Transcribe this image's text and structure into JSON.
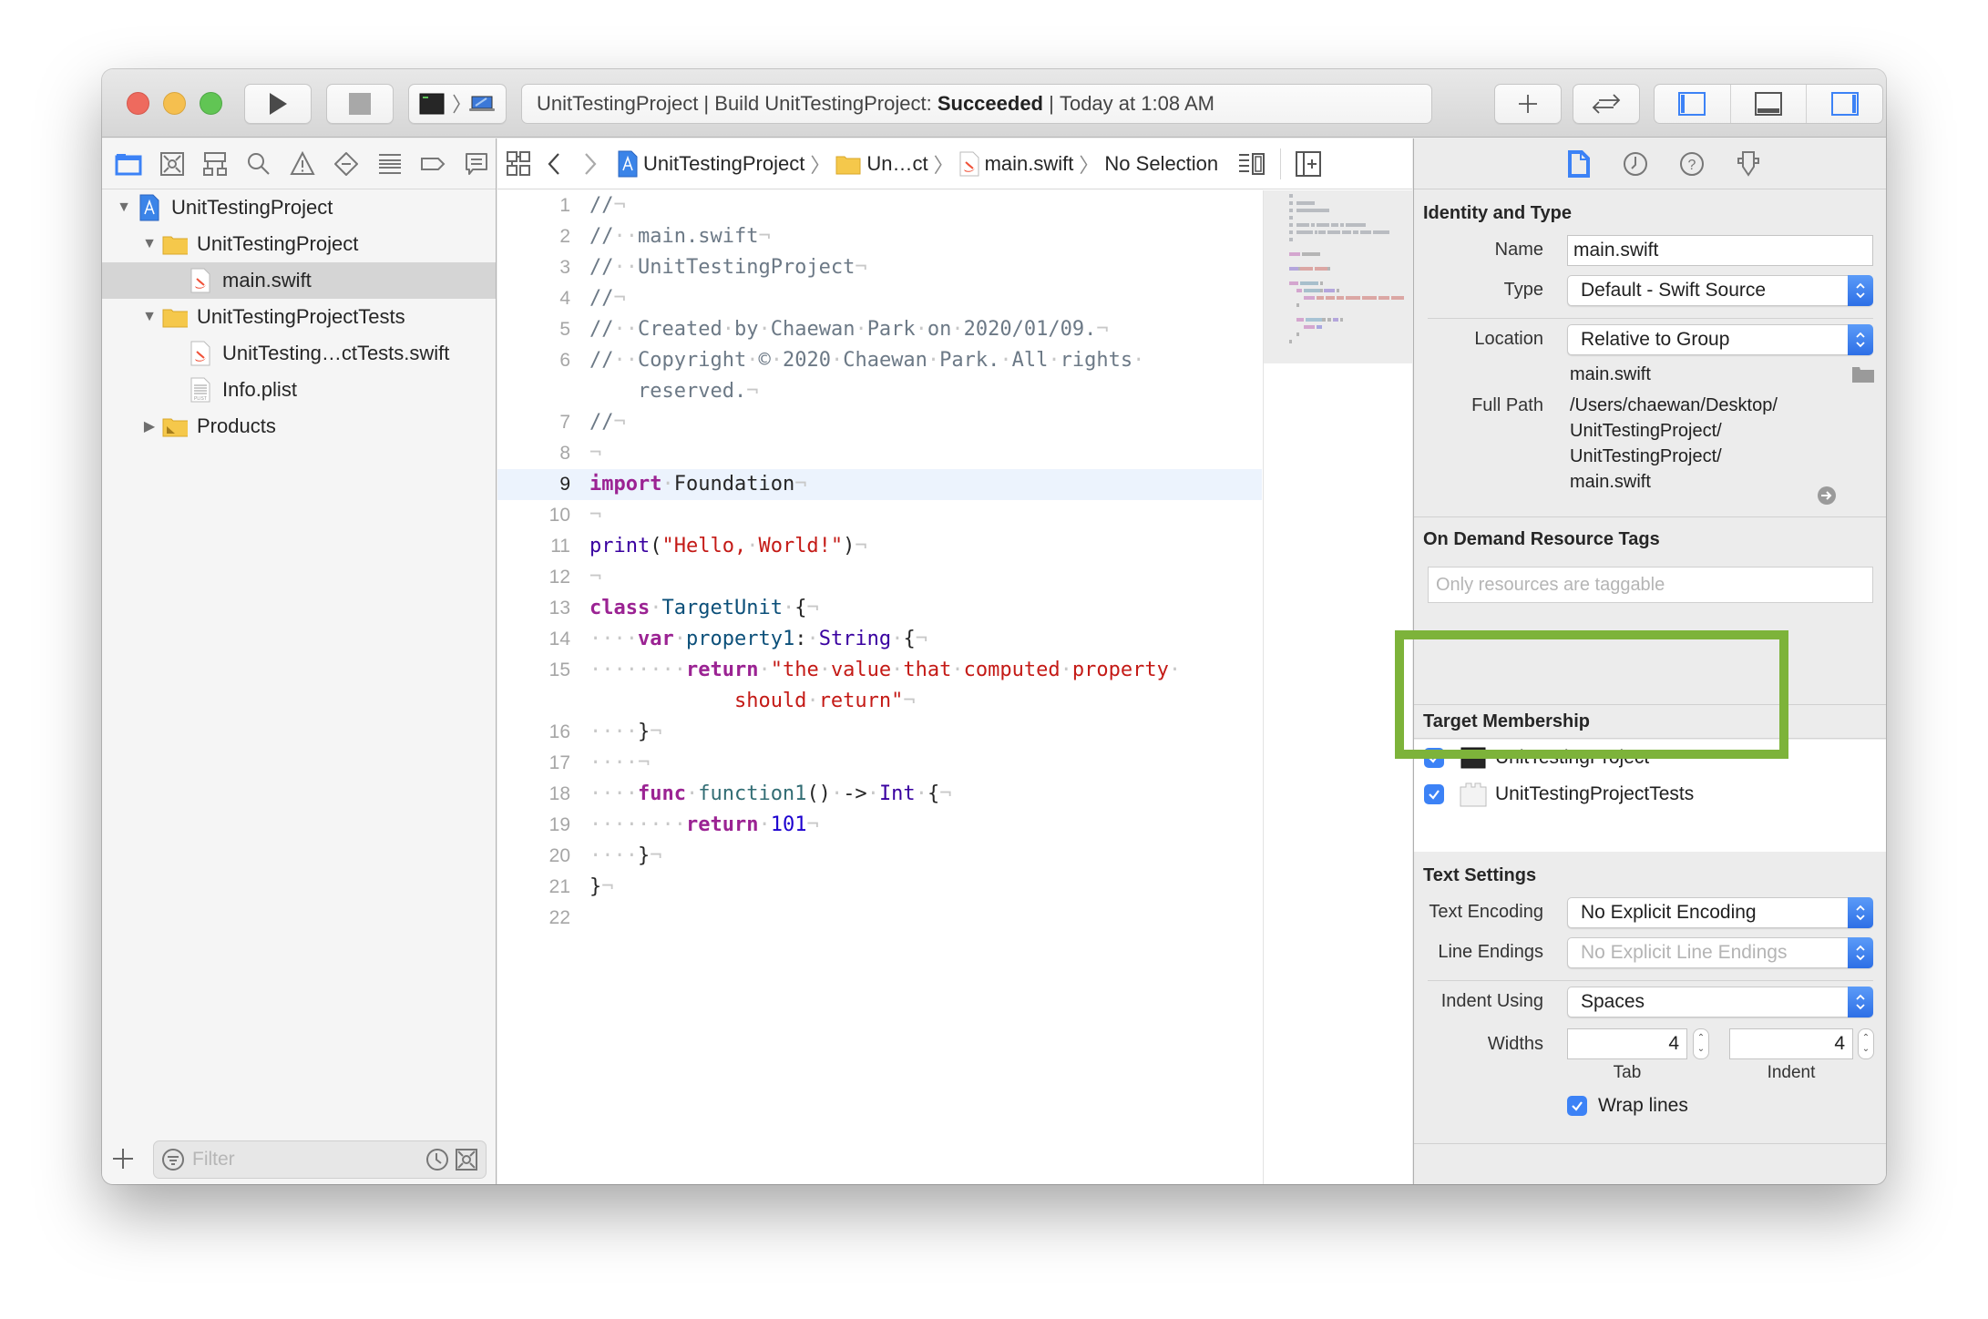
{
  "window": {
    "controls": [
      "close",
      "minimize",
      "zoom"
    ]
  },
  "toolbar": {
    "run_icon": "play-icon",
    "stop_icon": "stop-icon",
    "scheme_icon": "terminal-app-icon",
    "destination_icon": "macbook-icon",
    "status": {
      "project": "UnitTestingProject",
      "separator": " | ",
      "action": "Build UnitTestingProject: ",
      "result": "Succeeded",
      "time": "Today at 1:08 AM"
    },
    "library_icon": "plus-icon",
    "review_icon": "swap-arrows-icon",
    "layout_toggles": [
      {
        "name": "navigator",
        "active": true
      },
      {
        "name": "debug-area",
        "active": false
      },
      {
        "name": "inspector",
        "active": true
      }
    ]
  },
  "navigator": {
    "tabs": [
      {
        "icon": "folder-icon",
        "active": true
      },
      {
        "icon": "source-control-icon"
      },
      {
        "icon": "symbol-hierarchy-icon"
      },
      {
        "icon": "search-icon"
      },
      {
        "icon": "warning-icon"
      },
      {
        "icon": "test-diamond-icon"
      },
      {
        "icon": "debug-list-icon"
      },
      {
        "icon": "breakpoint-icon"
      },
      {
        "icon": "report-bubble-icon"
      }
    ],
    "tree": [
      {
        "label": "UnitTestingProject",
        "level": 0,
        "expanded": true,
        "icon": "xcode-project-icon"
      },
      {
        "label": "UnitTestingProject",
        "level": 1,
        "expanded": true,
        "icon": "folder-icon"
      },
      {
        "label": "main.swift",
        "level": 2,
        "icon": "swift-file-icon",
        "selected": true
      },
      {
        "label": "UnitTestingProjectTests",
        "level": 1,
        "expanded": true,
        "icon": "folder-icon"
      },
      {
        "label": "UnitTesting…ctTests.swift",
        "level": 2,
        "icon": "swift-file-icon"
      },
      {
        "label": "Info.plist",
        "level": 2,
        "icon": "plist-file-icon"
      },
      {
        "label": "Products",
        "level": 1,
        "expanded": false,
        "icon": "products-folder-icon"
      }
    ],
    "filter_placeholder": "Filter"
  },
  "editor": {
    "jump_bar": [
      {
        "label": "UnitTestingProject",
        "icon": "xcode-project-icon"
      },
      {
        "label": "Un…ct",
        "icon": "folder-icon"
      },
      {
        "label": "main.swift",
        "icon": "swift-file-icon"
      },
      {
        "label": "No Selection"
      }
    ],
    "current_line": 9,
    "lines": [
      {
        "n": "1",
        "tokens": [
          [
            "cm",
            "//"
          ],
          [
            "ws",
            "¬"
          ]
        ]
      },
      {
        "n": "2",
        "tokens": [
          [
            "cm",
            "//"
          ],
          [
            "ws",
            "··"
          ],
          [
            "cm",
            "main.swift"
          ],
          [
            "ws",
            "¬"
          ]
        ]
      },
      {
        "n": "3",
        "tokens": [
          [
            "cm",
            "//"
          ],
          [
            "ws",
            "··"
          ],
          [
            "cm",
            "UnitTestingProject"
          ],
          [
            "ws",
            "¬"
          ]
        ]
      },
      {
        "n": "4",
        "tokens": [
          [
            "cm",
            "//"
          ],
          [
            "ws",
            "¬"
          ]
        ]
      },
      {
        "n": "5",
        "tokens": [
          [
            "cm",
            "//"
          ],
          [
            "ws",
            "··"
          ],
          [
            "cm",
            "Created"
          ],
          [
            "ws",
            "·"
          ],
          [
            "cm",
            "by"
          ],
          [
            "ws",
            "·"
          ],
          [
            "cm",
            "Chaewan"
          ],
          [
            "ws",
            "·"
          ],
          [
            "cm",
            "Park"
          ],
          [
            "ws",
            "·"
          ],
          [
            "cm",
            "on"
          ],
          [
            "ws",
            "·"
          ],
          [
            "cm",
            "2020/01/09."
          ],
          [
            "ws",
            "¬"
          ]
        ]
      },
      {
        "n": "6",
        "tokens": [
          [
            "cm",
            "//"
          ],
          [
            "ws",
            "··"
          ],
          [
            "cm",
            "Copyright"
          ],
          [
            "ws",
            "·"
          ],
          [
            "cm",
            "©"
          ],
          [
            "ws",
            "·"
          ],
          [
            "cm",
            "2020"
          ],
          [
            "ws",
            "·"
          ],
          [
            "cm",
            "Chaewan"
          ],
          [
            "ws",
            "·"
          ],
          [
            "cm",
            "Park."
          ],
          [
            "ws",
            "·"
          ],
          [
            "cm",
            "All"
          ],
          [
            "ws",
            "·"
          ],
          [
            "cm",
            "rights"
          ],
          [
            "ws",
            "·"
          ],
          [
            "cm",
            "\n    reserved."
          ],
          [
            "ws",
            "¬"
          ]
        ]
      },
      {
        "n": "7",
        "tokens": [
          [
            "cm",
            "//"
          ],
          [
            "ws",
            "¬"
          ]
        ]
      },
      {
        "n": "8",
        "tokens": [
          [
            "ws",
            "¬"
          ]
        ]
      },
      {
        "n": "9",
        "tokens": [
          [
            "kw",
            "import"
          ],
          [
            "ws",
            "·"
          ],
          [
            "pl",
            "Foundation"
          ],
          [
            "ws",
            "¬"
          ]
        ]
      },
      {
        "n": "10",
        "tokens": [
          [
            "ws",
            "¬"
          ]
        ]
      },
      {
        "n": "11",
        "tokens": [
          [
            "typ",
            "print"
          ],
          [
            "pl",
            "("
          ],
          [
            "str",
            "\"Hello,"
          ],
          [
            "ws",
            "·"
          ],
          [
            "str",
            "World!\""
          ],
          [
            "pl",
            ")"
          ],
          [
            "ws",
            "¬"
          ]
        ]
      },
      {
        "n": "12",
        "tokens": [
          [
            "ws",
            "¬"
          ]
        ]
      },
      {
        "n": "13",
        "tokens": [
          [
            "kw",
            "class"
          ],
          [
            "ws",
            "·"
          ],
          [
            "tp",
            "TargetUnit"
          ],
          [
            "ws",
            "·"
          ],
          [
            "pl",
            "{"
          ],
          [
            "ws",
            "¬"
          ]
        ]
      },
      {
        "n": "14",
        "tokens": [
          [
            "ws",
            "····"
          ],
          [
            "kw",
            "var"
          ],
          [
            "ws",
            "·"
          ],
          [
            "tp",
            "property1"
          ],
          [
            "pl",
            ":"
          ],
          [
            "ws",
            "·"
          ],
          [
            "typ",
            "String"
          ],
          [
            "ws",
            "·"
          ],
          [
            "pl",
            "{"
          ],
          [
            "ws",
            "¬"
          ]
        ]
      },
      {
        "n": "15",
        "tokens": [
          [
            "ws",
            "········"
          ],
          [
            "kw",
            "return"
          ],
          [
            "ws",
            "·"
          ],
          [
            "str",
            "\"the"
          ],
          [
            "ws",
            "·"
          ],
          [
            "str",
            "value"
          ],
          [
            "ws",
            "·"
          ],
          [
            "str",
            "that"
          ],
          [
            "ws",
            "·"
          ],
          [
            "str",
            "computed"
          ],
          [
            "ws",
            "·"
          ],
          [
            "str",
            "property"
          ],
          [
            "ws",
            "·"
          ],
          [
            "str",
            "\n            should"
          ],
          [
            "ws",
            "·"
          ],
          [
            "str",
            "return\""
          ],
          [
            "ws",
            "¬"
          ]
        ]
      },
      {
        "n": "16",
        "tokens": [
          [
            "ws",
            "····"
          ],
          [
            "pl",
            "}"
          ],
          [
            "ws",
            "¬"
          ]
        ]
      },
      {
        "n": "17",
        "tokens": [
          [
            "ws",
            "····¬"
          ]
        ]
      },
      {
        "n": "18",
        "tokens": [
          [
            "ws",
            "····"
          ],
          [
            "kw",
            "func"
          ],
          [
            "ws",
            "·"
          ],
          [
            "fn",
            "function1"
          ],
          [
            "pl",
            "()"
          ],
          [
            "ws",
            "·"
          ],
          [
            "pl",
            "->"
          ],
          [
            "ws",
            "·"
          ],
          [
            "typ",
            "Int"
          ],
          [
            "ws",
            "·"
          ],
          [
            "pl",
            "{"
          ],
          [
            "ws",
            "¬"
          ]
        ]
      },
      {
        "n": "19",
        "tokens": [
          [
            "ws",
            "········"
          ],
          [
            "kw",
            "return"
          ],
          [
            "ws",
            "·"
          ],
          [
            "num",
            "101"
          ],
          [
            "ws",
            "¬"
          ]
        ]
      },
      {
        "n": "20",
        "tokens": [
          [
            "ws",
            "····"
          ],
          [
            "pl",
            "}"
          ],
          [
            "ws",
            "¬"
          ]
        ]
      },
      {
        "n": "21",
        "tokens": [
          [
            "pl",
            "}"
          ],
          [
            "ws",
            "¬"
          ]
        ]
      },
      {
        "n": "22",
        "tokens": []
      }
    ]
  },
  "inspector": {
    "tabs": [
      {
        "icon": "file-inspector-icon",
        "active": true
      },
      {
        "icon": "history-clock-icon"
      },
      {
        "icon": "quick-help-icon"
      },
      {
        "icon": "accessibility-pin-icon"
      }
    ],
    "identity": {
      "title": "Identity and Type",
      "name_label": "Name",
      "name_value": "main.swift",
      "type_label": "Type",
      "type_value": "Default - Swift Source",
      "location_label": "Location",
      "location_value": "Relative to Group",
      "relative_path": "main.swift",
      "full_path_label": "Full Path",
      "full_path_lines": [
        "/Users/chaewan/Desktop/",
        "UnitTestingProject/",
        "UnitTestingProject/",
        "main.swift"
      ]
    },
    "odr": {
      "title": "On Demand Resource Tags",
      "placeholder": "Only resources are taggable"
    },
    "target_membership": {
      "title": "Target Membership",
      "targets": [
        {
          "label": "UnitTestingProject",
          "checked": true,
          "icon": "terminal-app-icon"
        },
        {
          "label": "UnitTestingProjectTests",
          "checked": true,
          "icon": "test-bundle-icon"
        }
      ],
      "highlight_color": "#7db33a"
    },
    "text_settings": {
      "title": "Text Settings",
      "encoding_label": "Text Encoding",
      "encoding_value": "No Explicit Encoding",
      "line_endings_label": "Line Endings",
      "line_endings_value": "No Explicit Line Endings",
      "indent_label": "Indent Using",
      "indent_value": "Spaces",
      "widths_label": "Widths",
      "tab_width": "4",
      "indent_width": "4",
      "tab_caption": "Tab",
      "indent_caption": "Indent",
      "wrap_label": "Wrap lines",
      "wrap_checked": true
    }
  },
  "colors": {
    "accent": "#3c82f6",
    "selection": "#d5d5d5",
    "current_line": "#ecf3fd",
    "highlight_box": "#7db33a"
  }
}
